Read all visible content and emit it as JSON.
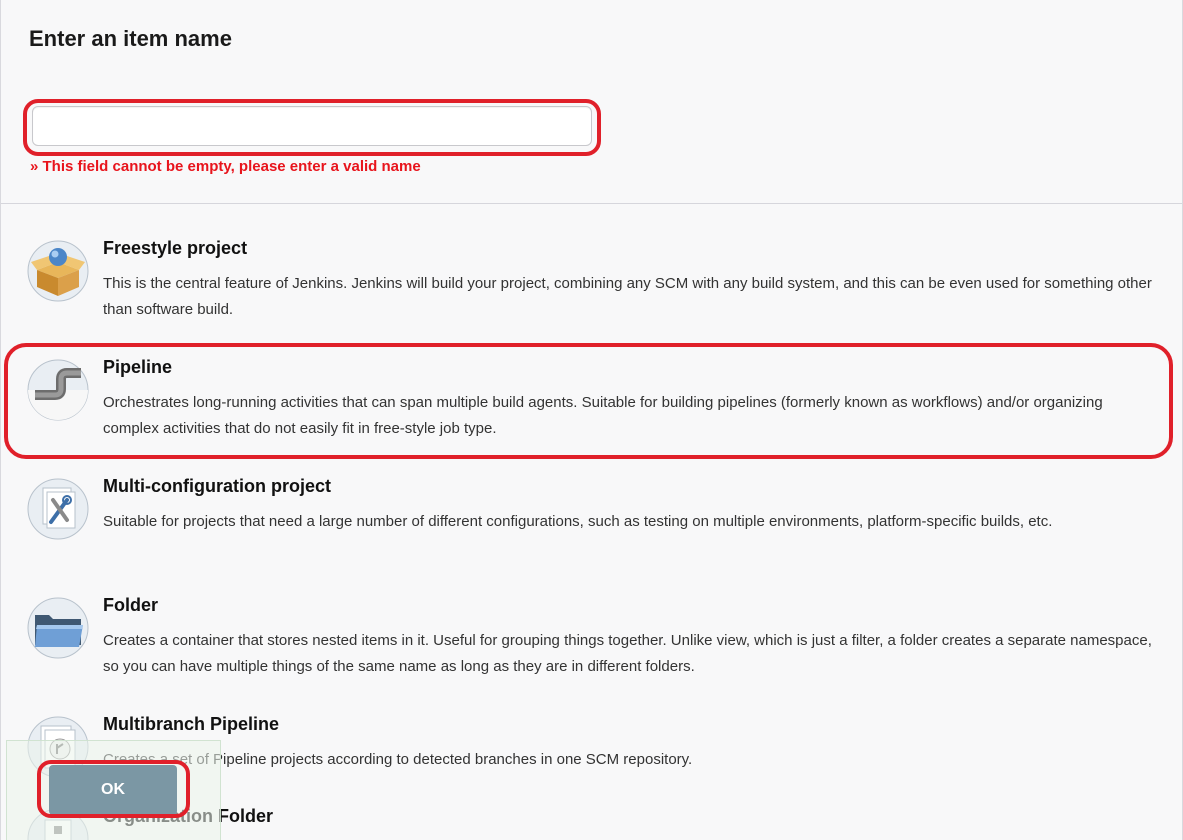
{
  "header": {
    "title": "Enter an item name"
  },
  "name_input": {
    "value": "",
    "placeholder": ""
  },
  "error": {
    "message": "» This field cannot be empty, please enter a valid name"
  },
  "items": [
    {
      "title": "Freestyle project",
      "description": "This is the central feature of Jenkins. Jenkins will build your project, combining any SCM with any build system, and this can be even used for something other than software build.",
      "icon": "freestyle-box-icon"
    },
    {
      "title": "Pipeline",
      "description": "Orchestrates long-running activities that can span multiple build agents. Suitable for building pipelines (formerly known as workflows) and/or organizing complex activities that do not easily fit in free-style job type.",
      "icon": "pipe-icon"
    },
    {
      "title": "Multi-configuration project",
      "description": "Suitable for projects that need a large number of different configurations, such as testing on multiple environments, platform-specific builds, etc.",
      "icon": "multi-config-tools-icon"
    },
    {
      "title": "Folder",
      "description": "Creates a container that stores nested items in it. Useful for grouping things together. Unlike view, which is just a filter, a folder creates a separate namespace, so you can have multiple things of the same name as long as they are in different folders.",
      "icon": "folder-icon"
    },
    {
      "title": "Multibranch Pipeline",
      "description": "Creates a set of Pipeline projects according to detected branches in one SCM repository.",
      "icon": "multibranch-icon"
    },
    {
      "title": "Organization Folder",
      "description": "",
      "icon": "organization-folder-icon"
    }
  ],
  "ok_button": {
    "label": "OK"
  },
  "colors": {
    "highlight": "#e0202a",
    "error_text": "#e8141c",
    "ok_button_bg": "#7b97a4"
  }
}
